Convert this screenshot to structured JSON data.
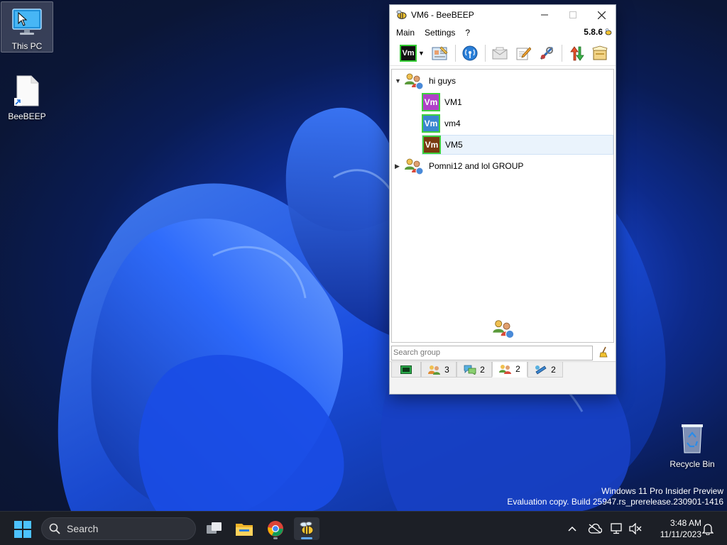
{
  "desktop": {
    "icons": [
      {
        "label": "This PC"
      },
      {
        "label": "BeeBEEP"
      },
      {
        "label": "Recycle Bin"
      }
    ],
    "watermark": {
      "line1": "Windows 11 Pro Insider Preview",
      "line2": "Evaluation copy. Build 25947.rs_prerelease.230901-1416"
    }
  },
  "window": {
    "title": "VM6 - BeeBEEP",
    "menu": {
      "main": "Main",
      "settings": "Settings",
      "help": "?"
    },
    "version": "5.8.6",
    "toolbar": {
      "user_badge": "Vm"
    },
    "tree": {
      "groups": [
        {
          "name": "hi guys",
          "expanded": true,
          "members": [
            {
              "name": "VM1",
              "badge": "Vm",
              "color": "#b040c8"
            },
            {
              "name": "vm4",
              "badge": "Vm",
              "color": "#3a86d0"
            },
            {
              "name": "VM5",
              "badge": "Vm",
              "color": "#7a3a10",
              "selected": true
            }
          ]
        },
        {
          "name": "Pomni12 and lol GROUP",
          "expanded": false
        }
      ]
    },
    "search": {
      "placeholder": "Search group",
      "value": ""
    },
    "tabs": [
      {
        "icon": "chat-window-icon",
        "count": ""
      },
      {
        "icon": "users-icon",
        "count": "3"
      },
      {
        "icon": "chats-icon",
        "count": "2"
      },
      {
        "icon": "groups-icon",
        "count": "2",
        "active": true
      },
      {
        "icon": "shares-icon",
        "count": "2"
      }
    ]
  },
  "taskbar": {
    "search_label": "Search",
    "clock": {
      "time": "3:48 AM",
      "date": "11/11/2023"
    }
  }
}
